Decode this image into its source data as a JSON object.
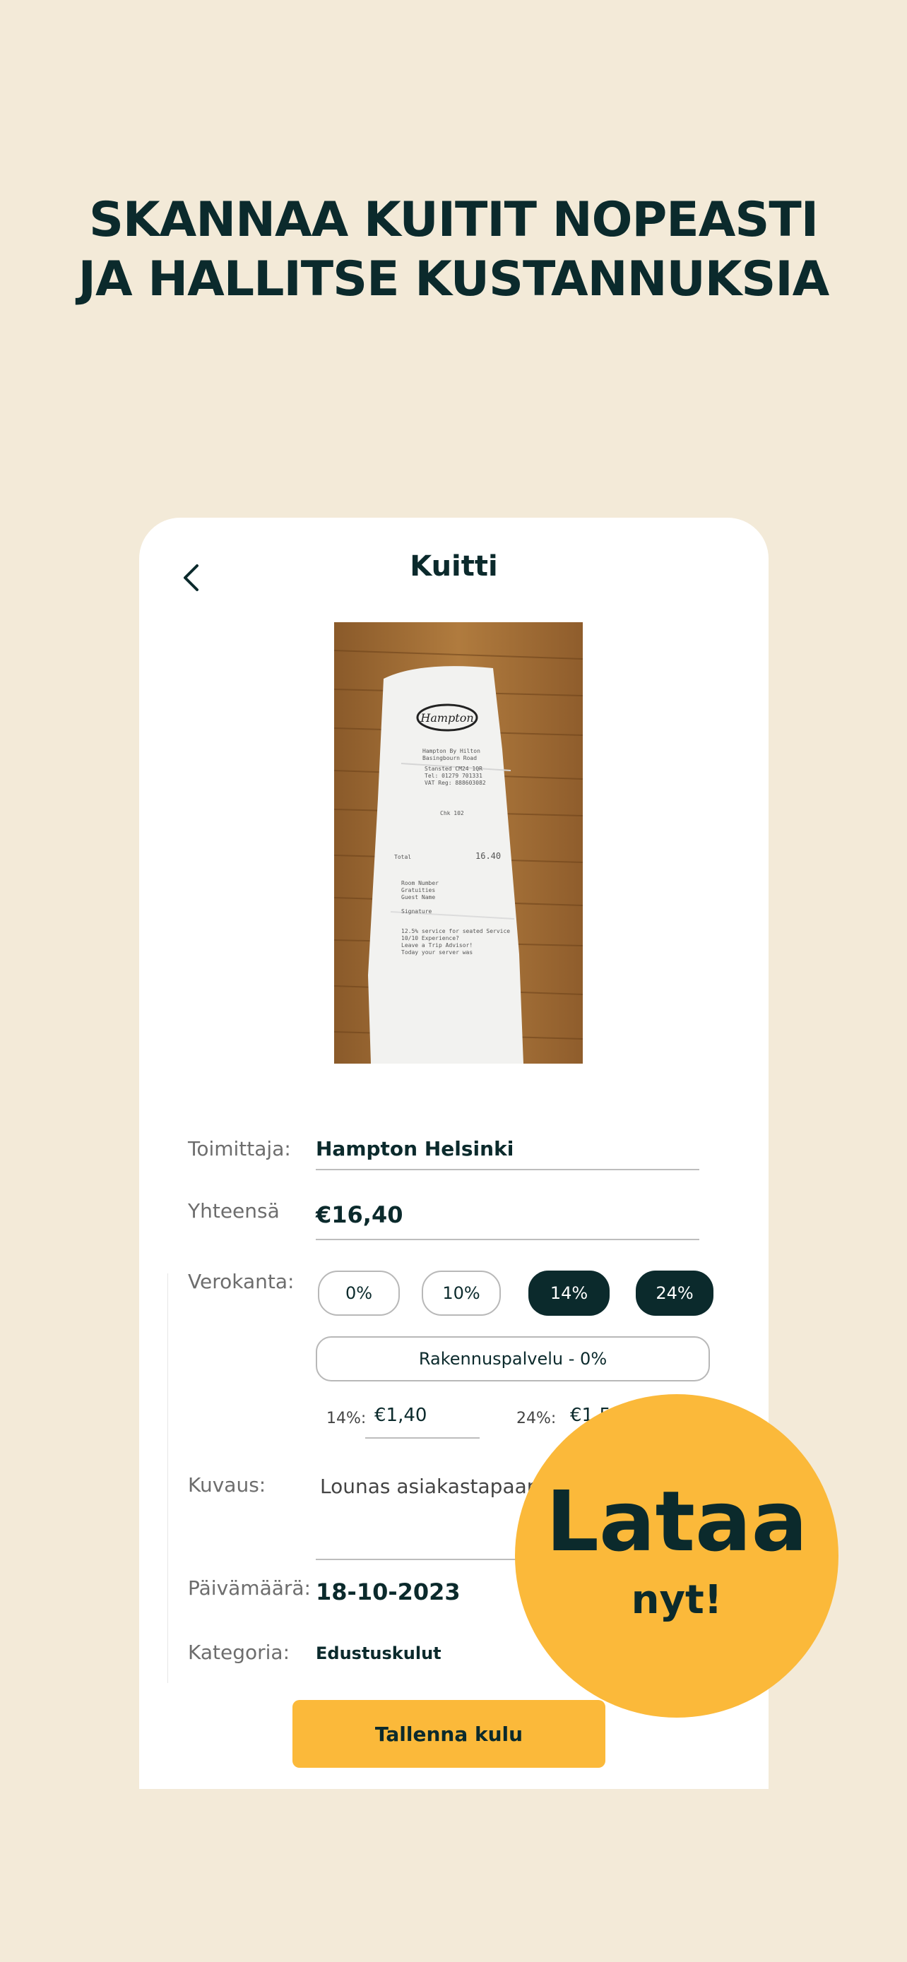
{
  "headline": {
    "line1": "SKANNAA KUITIT NOPEASTI",
    "line2": "JA HALLITSE KUSTANNUKSIA"
  },
  "screen": {
    "title": "Kuitti",
    "back_icon": "chevron-left-icon",
    "receipt": {
      "brand": "Hampton",
      "lines": [
        "Hampton By Hilton",
        "Basingbourn Road",
        "Stansted CM24 1QR",
        "Tel: 01279 701331",
        "VAT Reg: 888603082",
        "Chk 102",
        "Total",
        "16.40",
        "Room Number",
        "Gratuities",
        "Guest Name",
        "Signature",
        "12.5% service for seated Service",
        "10/10 Experience?",
        "Leave a Trip Advisor!",
        "Today your server was"
      ]
    }
  },
  "form": {
    "supplier_label": "Toimittaja:",
    "supplier_value": "Hampton Helsinki",
    "total_label": "Yhteensä",
    "total_value": "€16,40",
    "vat_label": "Verokanta:",
    "vat_options": [
      {
        "label": "0%",
        "selected": false
      },
      {
        "label": "10%",
        "selected": false
      },
      {
        "label": "14%",
        "selected": true
      },
      {
        "label": "24%",
        "selected": true
      }
    ],
    "construction_option": "Rakennuspalvelu - 0%",
    "vat14_label": "14%:",
    "vat14_value": "€1,40",
    "vat24_label": "24%:",
    "vat24_value": "€1,5",
    "description_label": "Kuvaus:",
    "description_value": "Lounas asiakastapaami",
    "date_label": "Päivämäärä:",
    "date_value": "18-10-2023",
    "category_label": "Kategoria:",
    "category_value": "Edustuskulut",
    "save_label": "Tallenna kulu"
  },
  "badge": {
    "big": "Lataa",
    "small": "nyt!"
  },
  "colors": {
    "background": "#f3ead8",
    "primary": "#0b2a2c",
    "accent": "#fbb93a"
  }
}
